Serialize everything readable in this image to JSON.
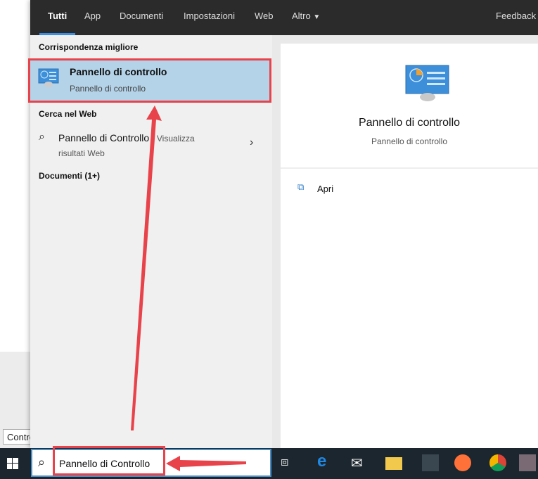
{
  "background": {
    "input_text": "Contro"
  },
  "tabs": [
    {
      "label": "Tutti",
      "active": true
    },
    {
      "label": "App"
    },
    {
      "label": "Documenti"
    },
    {
      "label": "Impostazioni"
    },
    {
      "label": "Web"
    },
    {
      "label": "Altro"
    }
  ],
  "feedback_label": "Feedback",
  "results": {
    "best_match_header": "Corrispondenza migliore",
    "best_match": {
      "title": "Pannello di controllo",
      "subtitle": "Pannello di controllo",
      "icon": "control-panel-icon"
    },
    "web_header": "Cerca nel Web",
    "web_item": {
      "query": "Pannello di Controllo",
      "suffix": " - Visualizza",
      "line2": "risultati Web"
    },
    "documents_header": "Documenti (1+)"
  },
  "preview": {
    "title": "Pannello di controllo",
    "subtitle": "Pannello di controllo",
    "actions": [
      {
        "label": "Apri",
        "icon": "open-icon"
      }
    ]
  },
  "taskbar": {
    "search_value": "Pannello di Controllo",
    "icons": [
      "task-view-icon",
      "edge-icon",
      "mail-icon",
      "file-explorer-icon",
      "app-icon",
      "firefox-icon",
      "chrome-icon",
      "app2-icon"
    ]
  },
  "colors": {
    "accent": "#3a8ee6",
    "highlight": "#b4d3e8",
    "annotation": "#e8434a"
  }
}
